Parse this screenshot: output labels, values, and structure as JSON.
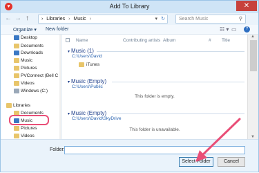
{
  "window": {
    "title": "Add To Library",
    "app_icon_glyph": "♥",
    "close_glyph": "✕"
  },
  "address_bar": {
    "back": "←",
    "forward": "→",
    "up": "↑",
    "crumbs": [
      "Libraries",
      "Music"
    ],
    "sep": "›",
    "path_prefix": "›",
    "search_placeholder": "Search Music"
  },
  "toolbar": {
    "organize": "Organize ▾",
    "new_folder": "New folder",
    "help": "?"
  },
  "nav": {
    "items": [
      {
        "label": "Desktop",
        "icon": "blue"
      },
      {
        "label": "Documents",
        "icon": "fold"
      },
      {
        "label": "Downloads",
        "icon": "blue"
      },
      {
        "label": "Music",
        "icon": "fold"
      },
      {
        "label": "Pictures",
        "icon": "fold"
      },
      {
        "label": "PVConnect (Bell C",
        "icon": "fold"
      },
      {
        "label": "Videos",
        "icon": "fold"
      },
      {
        "label": "Windows (C:)",
        "icon": "drive"
      }
    ],
    "libraries_label": "Libraries",
    "library_items": [
      {
        "label": "Documents",
        "icon": "fold"
      },
      {
        "label": "Music",
        "icon": "blue"
      },
      {
        "label": "Pictures",
        "icon": "fold"
      },
      {
        "label": "Videos",
        "icon": "fold"
      }
    ]
  },
  "columns": {
    "name": "Name",
    "contributing_artists": "Contributing artists",
    "album": "Album",
    "number": "#",
    "title": "Title"
  },
  "groups": [
    {
      "title": "Music (1)",
      "path": "C:\\Users\\David",
      "item": "iTunes"
    },
    {
      "title": "Music (Empty)",
      "path": "C:\\Users\\Public",
      "message": "This folder is empty."
    },
    {
      "title": "Music (Empty)",
      "path": "C:\\Users\\David\\SkyDrive",
      "message": "This folder is unavailable."
    }
  ],
  "footer": {
    "folder_label": "Folder:",
    "folder_value": "",
    "select_button": "Select Folder",
    "cancel_button": "Cancel"
  },
  "colors": {
    "accent_arrow": "#e94e77"
  }
}
